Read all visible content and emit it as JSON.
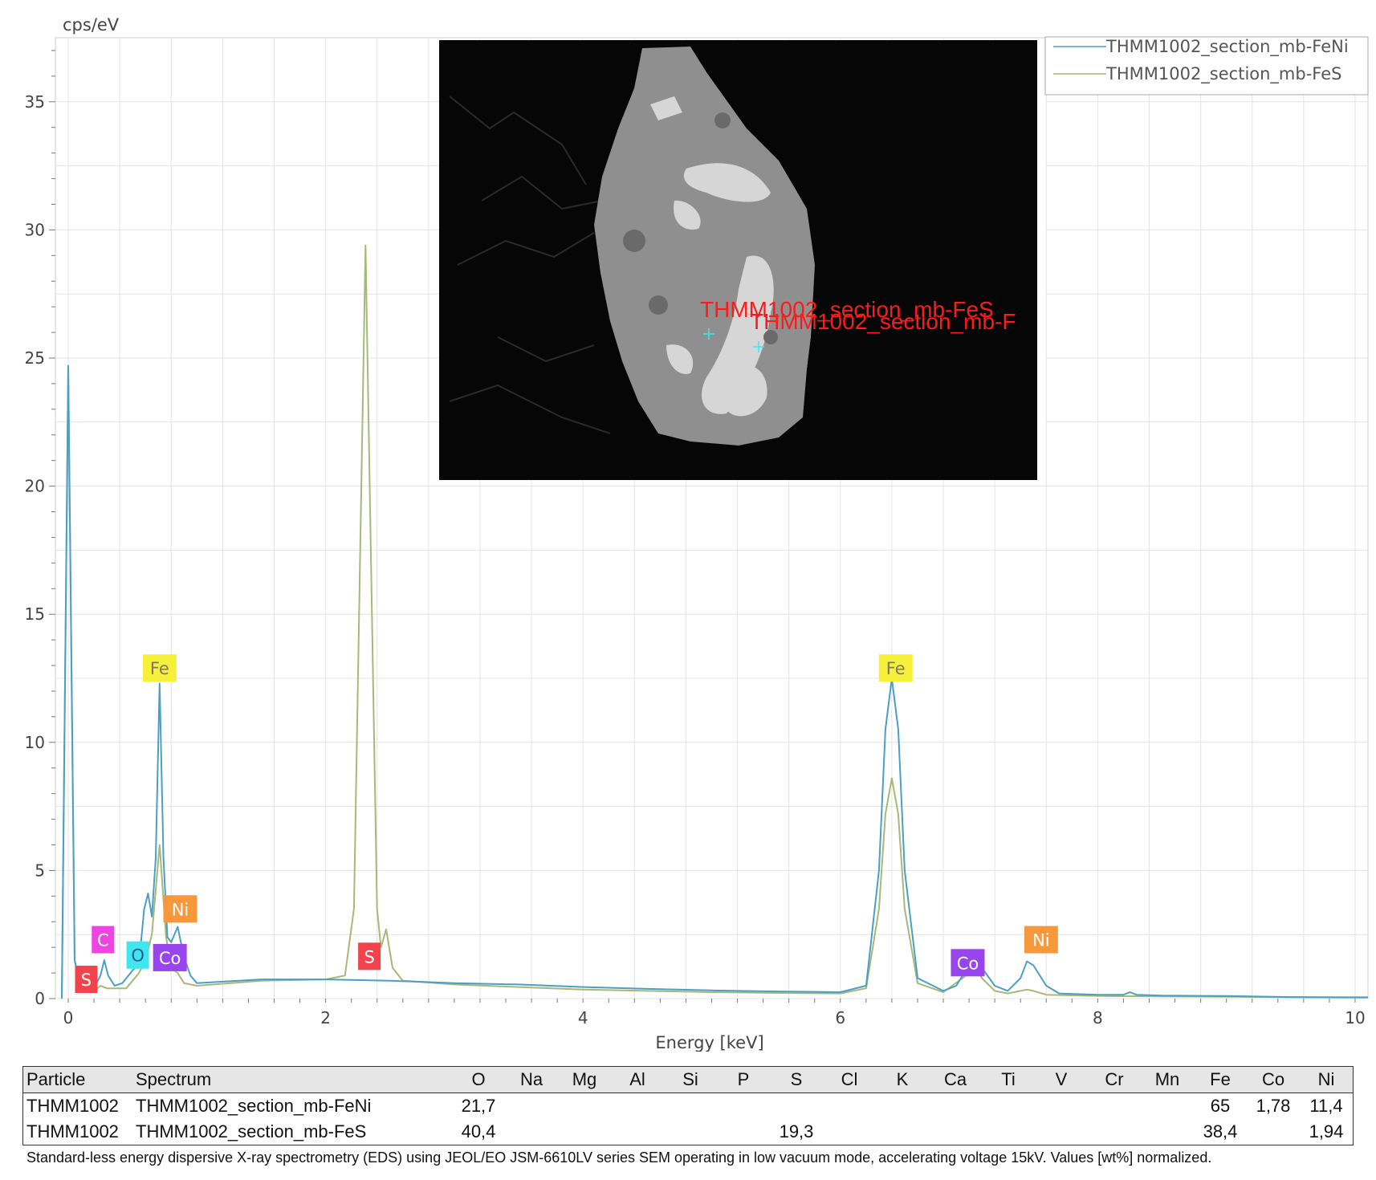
{
  "chart_data": {
    "type": "line",
    "ylabel": "cps/eV",
    "xlabel": "Energy [keV]",
    "xlim": [
      -0.1,
      10.1
    ],
    "ylim": [
      0,
      37.5
    ],
    "x_ticks": [
      "0",
      "2",
      "4",
      "6",
      "8",
      "10"
    ],
    "y_ticks": [
      "0",
      "5",
      "10",
      "15",
      "20",
      "25",
      "30",
      "35"
    ],
    "grid": true,
    "legend_position": "top-right",
    "series": [
      {
        "name": "THMM1002_section_mb-FeNi",
        "color": "#4a9fc6",
        "points": [
          [
            -0.05,
            0
          ],
          [
            0.0,
            24.7
          ],
          [
            0.05,
            1.5
          ],
          [
            0.1,
            0.3
          ],
          [
            0.15,
            0.3
          ],
          [
            0.2,
            0.4
          ],
          [
            0.25,
            0.9
          ],
          [
            0.28,
            1.5
          ],
          [
            0.31,
            0.9
          ],
          [
            0.36,
            0.5
          ],
          [
            0.42,
            0.6
          ],
          [
            0.5,
            1.1
          ],
          [
            0.55,
            1.4
          ],
          [
            0.59,
            3.5
          ],
          [
            0.62,
            4.1
          ],
          [
            0.65,
            3.2
          ],
          [
            0.68,
            5.5
          ],
          [
            0.71,
            12.3
          ],
          [
            0.74,
            5.5
          ],
          [
            0.77,
            2.4
          ],
          [
            0.8,
            2.2
          ],
          [
            0.85,
            2.8
          ],
          [
            0.9,
            1.6
          ],
          [
            0.95,
            0.9
          ],
          [
            1.0,
            0.6
          ],
          [
            1.5,
            0.75
          ],
          [
            2.0,
            0.75
          ],
          [
            2.5,
            0.7
          ],
          [
            3.0,
            0.6
          ],
          [
            3.5,
            0.55
          ],
          [
            4.0,
            0.45
          ],
          [
            4.5,
            0.38
          ],
          [
            5.0,
            0.32
          ],
          [
            5.5,
            0.28
          ],
          [
            6.0,
            0.25
          ],
          [
            6.2,
            0.5
          ],
          [
            6.3,
            5.0
          ],
          [
            6.35,
            10.5
          ],
          [
            6.4,
            12.5
          ],
          [
            6.45,
            10.5
          ],
          [
            6.5,
            5.0
          ],
          [
            6.6,
            0.8
          ],
          [
            6.8,
            0.3
          ],
          [
            6.9,
            0.5
          ],
          [
            7.0,
            1.3
          ],
          [
            7.05,
            1.8
          ],
          [
            7.1,
            1.2
          ],
          [
            7.2,
            0.5
          ],
          [
            7.3,
            0.3
          ],
          [
            7.4,
            0.8
          ],
          [
            7.45,
            1.45
          ],
          [
            7.5,
            1.3
          ],
          [
            7.6,
            0.5
          ],
          [
            7.7,
            0.2
          ],
          [
            8.0,
            0.15
          ],
          [
            8.2,
            0.15
          ],
          [
            8.25,
            0.25
          ],
          [
            8.3,
            0.15
          ],
          [
            8.5,
            0.12
          ],
          [
            9.0,
            0.1
          ],
          [
            9.5,
            0.06
          ],
          [
            10.0,
            0.05
          ],
          [
            10.1,
            0.05
          ]
        ]
      },
      {
        "name": "THMM1002_section_mb-FeS",
        "color": "#a8b878",
        "points": [
          [
            -0.05,
            0
          ],
          [
            0.0,
            24.5
          ],
          [
            0.05,
            1.5
          ],
          [
            0.1,
            0.3
          ],
          [
            0.2,
            0.3
          ],
          [
            0.25,
            0.5
          ],
          [
            0.3,
            0.4
          ],
          [
            0.45,
            0.4
          ],
          [
            0.5,
            0.7
          ],
          [
            0.55,
            1.0
          ],
          [
            0.6,
            1.5
          ],
          [
            0.65,
            2.5
          ],
          [
            0.71,
            6.0
          ],
          [
            0.76,
            2.4
          ],
          [
            0.8,
            1.2
          ],
          [
            0.85,
            1.0
          ],
          [
            0.9,
            0.6
          ],
          [
            1.0,
            0.5
          ],
          [
            1.5,
            0.7
          ],
          [
            2.0,
            0.75
          ],
          [
            2.15,
            0.9
          ],
          [
            2.22,
            3.5
          ],
          [
            2.26,
            15.0
          ],
          [
            2.31,
            29.4
          ],
          [
            2.36,
            15.0
          ],
          [
            2.4,
            3.5
          ],
          [
            2.43,
            2.0
          ],
          [
            2.47,
            2.7
          ],
          [
            2.52,
            1.2
          ],
          [
            2.6,
            0.7
          ],
          [
            3.0,
            0.55
          ],
          [
            3.5,
            0.45
          ],
          [
            4.0,
            0.35
          ],
          [
            4.5,
            0.3
          ],
          [
            5.0,
            0.25
          ],
          [
            5.5,
            0.22
          ],
          [
            6.0,
            0.2
          ],
          [
            6.2,
            0.4
          ],
          [
            6.3,
            3.5
          ],
          [
            6.35,
            7.2
          ],
          [
            6.4,
            8.6
          ],
          [
            6.45,
            7.2
          ],
          [
            6.5,
            3.5
          ],
          [
            6.6,
            0.6
          ],
          [
            6.8,
            0.25
          ],
          [
            6.95,
            0.8
          ],
          [
            7.05,
            1.2
          ],
          [
            7.1,
            0.8
          ],
          [
            7.2,
            0.3
          ],
          [
            7.3,
            0.2
          ],
          [
            7.45,
            0.35
          ],
          [
            7.5,
            0.3
          ],
          [
            7.6,
            0.15
          ],
          [
            8.0,
            0.1
          ],
          [
            9.0,
            0.07
          ],
          [
            10.0,
            0.04
          ],
          [
            10.1,
            0.04
          ]
        ]
      }
    ],
    "peak_labels": [
      {
        "text": "S",
        "x": 0.14,
        "y": 0.75,
        "fill": "#f0434c",
        "textColor": "#fff"
      },
      {
        "text": "C",
        "x": 0.27,
        "y": 2.3,
        "fill": "#ee44e4",
        "textColor": "#fff"
      },
      {
        "text": "O",
        "x": 0.54,
        "y": 1.7,
        "fill": "#3ee6ee",
        "textColor": "#2a5a99"
      },
      {
        "text": "Co",
        "x": 0.79,
        "y": 1.6,
        "fill": "#9945ee",
        "textColor": "#fff"
      },
      {
        "text": "Ni",
        "x": 0.87,
        "y": 3.5,
        "fill": "#f7983a",
        "textColor": "#fff"
      },
      {
        "text": "Fe",
        "x": 0.71,
        "y": 12.9,
        "fill": "#f6f03a",
        "textColor": "#777"
      },
      {
        "text": "S",
        "x": 2.34,
        "y": 1.65,
        "fill": "#f0434c",
        "textColor": "#fff"
      },
      {
        "text": "Fe",
        "x": 6.43,
        "y": 12.9,
        "fill": "#f6f03a",
        "textColor": "#777"
      },
      {
        "text": "Co",
        "x": 6.99,
        "y": 1.4,
        "fill": "#9945ee",
        "textColor": "#fff"
      },
      {
        "text": "Ni",
        "x": 7.56,
        "y": 2.3,
        "fill": "#f7983a",
        "textColor": "#fff"
      }
    ]
  },
  "sem_image": {
    "labels": [
      "THMM1002_section_mb-FeS",
      "THMM1002_section_mb-F"
    ]
  },
  "table": {
    "headers": [
      "Particle",
      "Spectrum",
      "O",
      "Na",
      "Mg",
      "Al",
      "Si",
      "P",
      "S",
      "Cl",
      "K",
      "Ca",
      "Ti",
      "V",
      "Cr",
      "Mn",
      "Fe",
      "Co",
      "Ni"
    ],
    "rows": [
      [
        "THMM1002",
        "THMM1002_section_mb-FeNi",
        "21,7",
        "",
        "",
        "",
        "",
        "",
        "",
        "",
        "",
        "",
        "",
        "",
        "",
        "",
        "65",
        "1,78",
        "11,4"
      ],
      [
        "THMM1002",
        "THMM1002_section_mb-FeS",
        "40,4",
        "",
        "",
        "",
        "",
        "",
        "19,3",
        "",
        "",
        "",
        "",
        "",
        "",
        "",
        "38,4",
        "",
        "1,94"
      ]
    ]
  },
  "caption": "Standard-less energy dispersive X-ray spectrometry (EDS) using JEOL/EO JSM-6610LV series SEM operating in low vacuum mode, accelerating voltage 15kV. Values [wt%] normalized."
}
